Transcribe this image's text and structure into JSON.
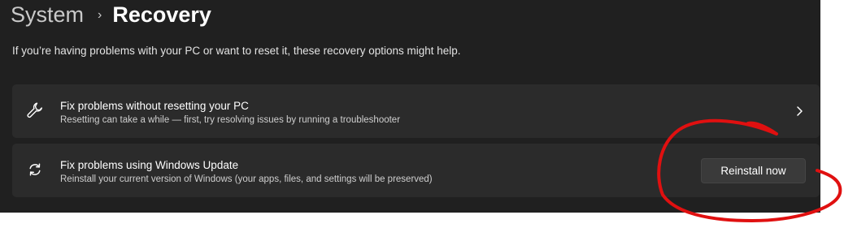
{
  "breadcrumb": {
    "parent": "System",
    "separator": "›",
    "current": "Recovery"
  },
  "subtitle": "If you’re having problems with your PC or want to reset it, these recovery options might help.",
  "cards": [
    {
      "icon": "wrench-icon",
      "title": "Fix problems without resetting your PC",
      "description": "Resetting can take a while — first, try resolving issues by running a troubleshooter",
      "action_icon": "chevron-right-icon"
    },
    {
      "icon": "sync-icon",
      "title": "Fix problems using Windows Update",
      "description": "Reinstall your current version of Windows (your apps, files, and settings will be preserved)",
      "button_label": "Reinstall now"
    }
  ],
  "colors": {
    "background": "#202020",
    "card": "#2b2b2b",
    "annotation": "#e01010"
  }
}
